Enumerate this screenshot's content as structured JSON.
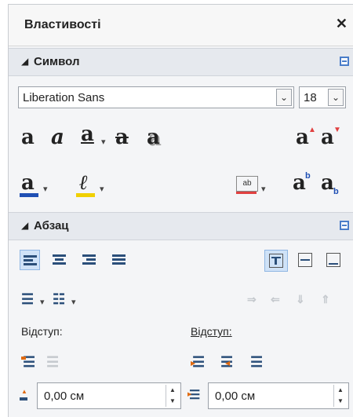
{
  "panel": {
    "title": "Властивості",
    "close": "✕"
  },
  "symbol": {
    "section_title": "Символ",
    "font_name": "Liberation Sans",
    "font_size": "18",
    "dropdown_arrow": "⌄",
    "glyphs": {
      "bold": "a",
      "italic": "a",
      "underline": "a",
      "strike": "a",
      "shadow": "a",
      "grow": "a",
      "shrink": "a",
      "font_color": "a",
      "highlight": "ℓ",
      "spacing": "ab",
      "super": "a",
      "sub": "a"
    }
  },
  "paragraph": {
    "section_title": "Абзац",
    "indent_label_left": "Відступ:",
    "indent_label_right": "Відступ:",
    "spacing_value": "0,00 см",
    "indent_value": "0,00 см"
  },
  "colors": {
    "accent": "#4a7dc9",
    "font_color_bar": "#1f4fb4",
    "highlight_bar": "#f0d000",
    "spacing_red": "#e04040"
  }
}
